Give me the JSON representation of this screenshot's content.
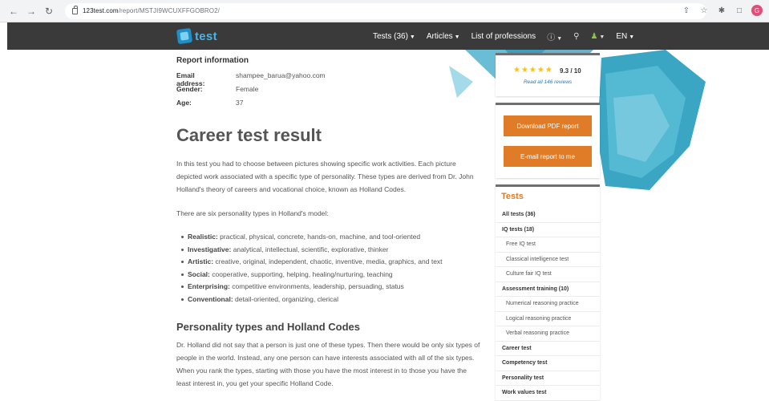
{
  "browser": {
    "url_domain": "123test.com",
    "url_path": "/report/MSTJI9WCUXFFGOBRO2/",
    "avatar_letter": "G"
  },
  "header": {
    "logo_text": "test",
    "nav": [
      {
        "label": "Tests (36)",
        "caret": true
      },
      {
        "label": "Articles",
        "caret": true
      },
      {
        "label": "List of professions",
        "caret": false
      }
    ],
    "language": "EN"
  },
  "report": {
    "heading": "Report information",
    "fields": [
      {
        "label": "Email address:",
        "value": "shampee_barua@yahoo.com"
      },
      {
        "label": "Gender:",
        "value": "Female"
      },
      {
        "label": "Age:",
        "value": "37"
      }
    ]
  },
  "main": {
    "title": "Career test result",
    "intro": "In this test you had to choose between pictures showing specific work activities. Each picture depicted work associated with a specific type of personality. These types are derived from Dr. John Holland's theory of careers and vocational choice, known as Holland Codes.",
    "six_types": "There are six personality types in Holland's model:",
    "types": [
      {
        "name": "Realistic:",
        "desc": "practical, physical, concrete, hands-on, machine, and tool-oriented"
      },
      {
        "name": "Investigative:",
        "desc": "analytical, intellectual, scientific, explorative, thinker"
      },
      {
        "name": "Artistic:",
        "desc": "creative, original, independent, chaotic, inventive, media, graphics, and text"
      },
      {
        "name": "Social:",
        "desc": "cooperative, supporting, helping, healing/nurturing, teaching"
      },
      {
        "name": "Enterprising:",
        "desc": "competitive environments, leadership, persuading, status"
      },
      {
        "name": "Conventional:",
        "desc": "detail-oriented, organizing, clerical"
      }
    ],
    "subheading": "Personality types and Holland Codes",
    "holland_para": "Dr. Holland did not say that a person is just one of these types. Then there would be only six types of people in the world. Instead, any one person can have interests associated with all of the six types. When you rank the types, starting with those you have the most interest in to those you have the least interest in, you get your specific Holland Code."
  },
  "sidebar": {
    "rating": {
      "stars": "★★★★★",
      "score": "9.3 / 10",
      "reviews_link": "Read all 146 reviews"
    },
    "download_pdf": "Download PDF report",
    "email_report": "E-mail report to me",
    "tests_title": "Tests",
    "tests": [
      {
        "label": "All tests (36)",
        "level": "cat"
      },
      {
        "label": "IQ tests (18)",
        "level": "cat"
      },
      {
        "label": "Free IQ test",
        "level": "sub"
      },
      {
        "label": "Classical intelligence test",
        "level": "sub"
      },
      {
        "label": "Culture fair IQ test",
        "level": "sub"
      },
      {
        "label": "Assessment training (10)",
        "level": "cat"
      },
      {
        "label": "Numerical reasoning practice",
        "level": "sub"
      },
      {
        "label": "Logical reasoning practice",
        "level": "sub"
      },
      {
        "label": "Verbal reasoning practice",
        "level": "sub"
      },
      {
        "label": "Career test",
        "level": "cat"
      },
      {
        "label": "Competency test",
        "level": "cat"
      },
      {
        "label": "Personality test",
        "level": "cat"
      },
      {
        "label": "Work values test",
        "level": "cat"
      }
    ]
  },
  "colors": {
    "header_bg": "#3a3a3a",
    "accent_orange": "#e07b27",
    "logo_blue": "#49b4e6",
    "hex_teal": "#3aa6c4",
    "star_yellow": "#f4c21f",
    "link_blue": "#2a7ab8"
  }
}
